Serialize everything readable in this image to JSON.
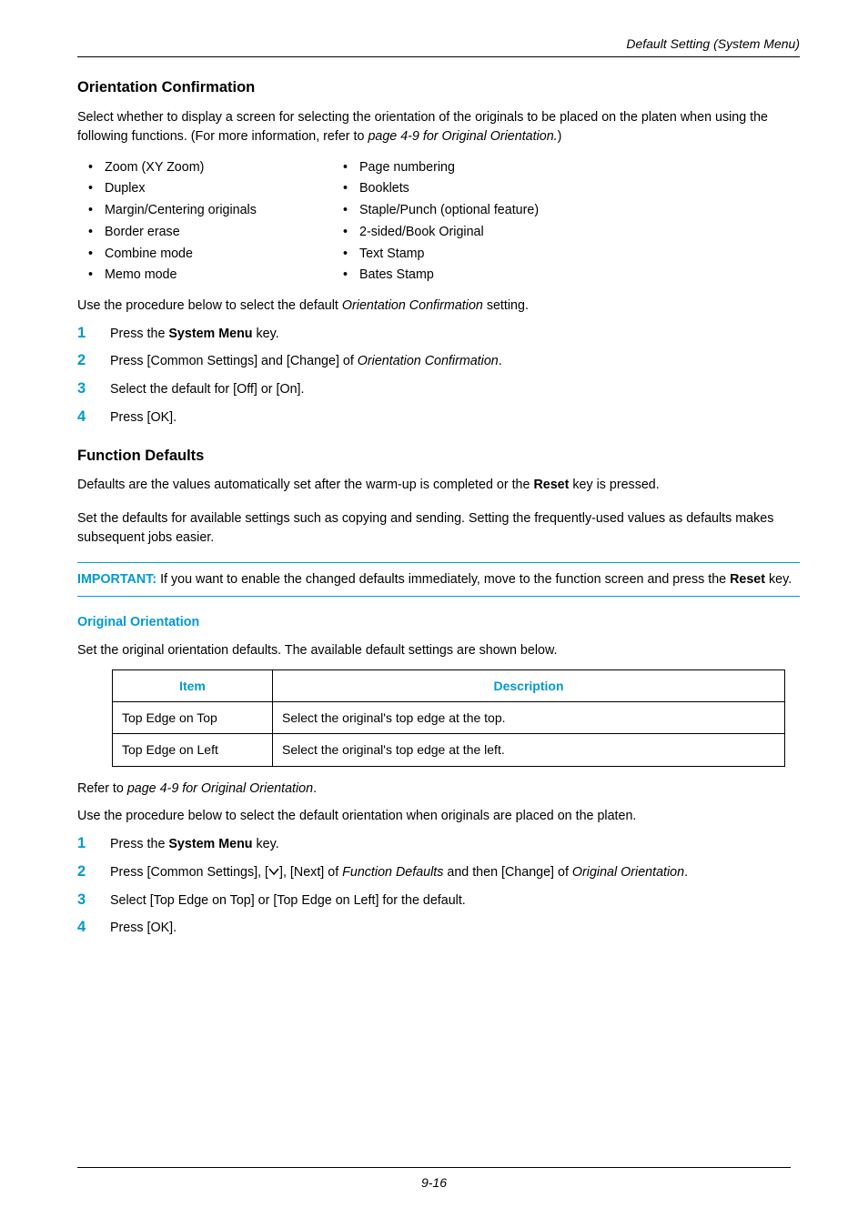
{
  "header": {
    "section": "Default Setting (System Menu)"
  },
  "s1": {
    "title": "Orientation Confirmation",
    "intro": "Select whether to display a screen for selecting the orientation of the originals to be placed on the platen when using the following functions. (For more information, refer to page 4-9 for Original Orientation.)",
    "left": [
      "Zoom (XY Zoom)",
      "Duplex",
      "Margin/Centering originals",
      "Border erase",
      "Combine mode",
      "Memo mode"
    ],
    "right": [
      "Page numbering",
      "Booklets",
      "Staple/Punch (optional feature)",
      "2-sided/Book Original",
      "Text Stamp",
      "Bates Stamp"
    ],
    "useproc": "Use the procedure below to select the default Orientation Confirmation setting.",
    "steps": {
      "s1_pre": "Press the ",
      "s1_bold": "System Menu",
      "s1_post": " key.",
      "s2_pre": "Press [Common Settings] and [Change] of ",
      "s2_it": "Orientation Confirmation",
      "s2_post": ".",
      "s3": "Select the default for [Off] or [On].",
      "s4": "Press [OK]."
    }
  },
  "s2": {
    "title": "Function Defaults",
    "p1_pre": "Defaults are the values automatically set after the warm-up is completed or the ",
    "p1_bold": "Reset",
    "p1_post": " key is pressed.",
    "p2": "Set the defaults for available settings such as copying and sending. Setting the frequently-used values as defaults makes subsequent jobs easier.",
    "callout_label": "IMPORTANT:",
    "callout_pre": " If you want to enable the changed defaults immediately, move to the function screen and press the ",
    "callout_bold": "Reset",
    "callout_post": " key."
  },
  "s3": {
    "title": "Original Orientation",
    "intro": "Set the original orientation defaults. The available default settings are shown below.",
    "th1": "Item",
    "th2": "Description",
    "rows": [
      {
        "item": "Top Edge on Top",
        "desc": "Select the original's top edge at the top."
      },
      {
        "item": "Top Edge on Left",
        "desc": "Select the original's top edge at the left."
      }
    ],
    "ref_pre": "Refer to ",
    "ref_it": "page 4-9 for Original Orientation",
    "ref_post": ".",
    "useproc": "Use the procedure below to select the default orientation when originals are placed on the platen.",
    "steps": {
      "s1_pre": "Press the ",
      "s1_bold": "System Menu",
      "s1_post": " key.",
      "s2_a": "Press [Common Settings], [",
      "s2_b": "], [Next] of ",
      "s2_it": "Function Defaults",
      "s2_c": " and then [Change] of ",
      "s2_it2": "Original Orientation",
      "s2_post": ".",
      "s3": "Select [Top Edge on Top] or [Top Edge on Left] for the default.",
      "s4": "Press [OK]."
    }
  },
  "footer": {
    "page": "9-16"
  }
}
